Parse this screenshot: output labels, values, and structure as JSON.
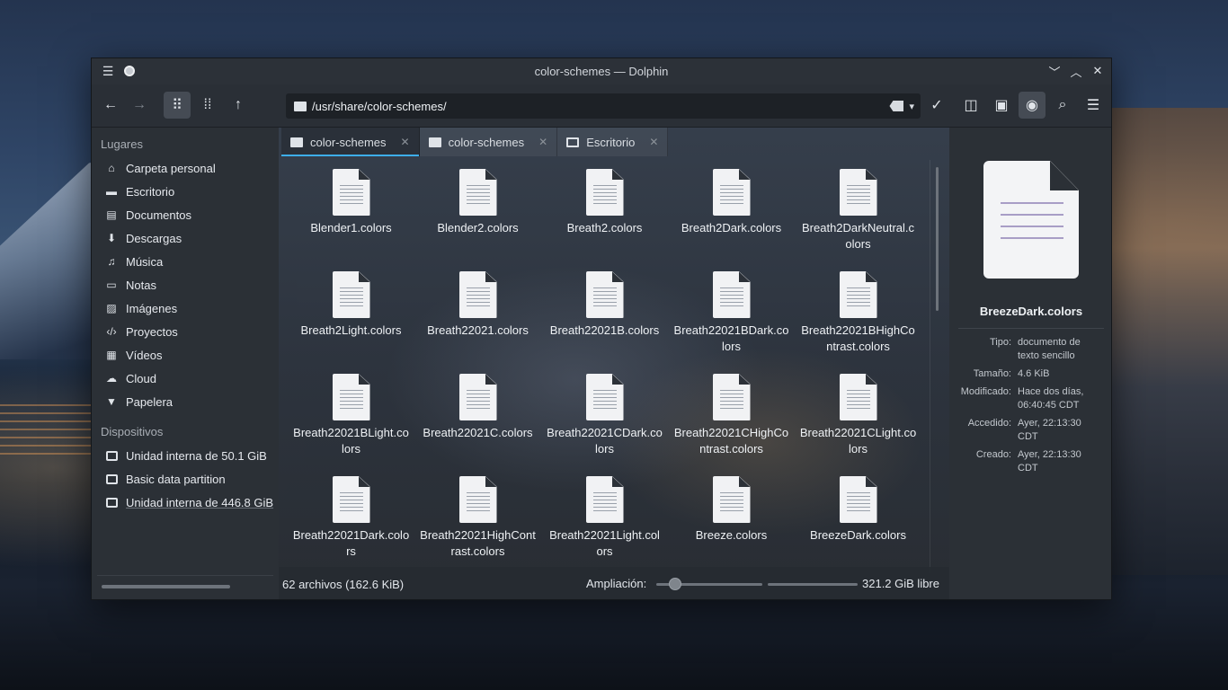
{
  "window": {
    "title": "color-schemes — Dolphin"
  },
  "toolbar": {
    "path": "/usr/share/color-schemes/"
  },
  "sidebar": {
    "places_header": "Lugares",
    "places": [
      {
        "label": "Carpeta personal",
        "icon": "home-icon"
      },
      {
        "label": "Escritorio",
        "icon": "desktop-icon"
      },
      {
        "label": "Documentos",
        "icon": "documents-icon"
      },
      {
        "label": "Descargas",
        "icon": "downloads-icon"
      },
      {
        "label": "Música",
        "icon": "music-icon"
      },
      {
        "label": "Notas",
        "icon": "folder-icon"
      },
      {
        "label": "Imágenes",
        "icon": "pictures-icon"
      },
      {
        "label": "Proyectos",
        "icon": "code-icon"
      },
      {
        "label": "Vídeos",
        "icon": "videos-icon"
      },
      {
        "label": "Cloud",
        "icon": "cloud-icon"
      },
      {
        "label": "Papelera",
        "icon": "trash-icon"
      }
    ],
    "devices_header": "Dispositivos",
    "devices": [
      {
        "label": "Unidad interna de 50.1 GiB"
      },
      {
        "label": "Basic data partition"
      },
      {
        "label": "Unidad interna de 446.8 GiB"
      }
    ]
  },
  "tabs": [
    {
      "label": "color-schemes",
      "active": true
    },
    {
      "label": "color-schemes",
      "active": false
    },
    {
      "label": "Escritorio",
      "active": false
    }
  ],
  "files": [
    "Blender1.colors",
    "Blender2.colors",
    "Breath2.colors",
    "Breath2Dark.colors",
    "Breath2DarkNeutral.colors",
    "Breath2Light.colors",
    "Breath22021.colors",
    "Breath22021B.colors",
    "Breath22021BDark.colors",
    "Breath22021BHighContrast.colors",
    "Breath22021BLight.colors",
    "Breath22021C.colors",
    "Breath22021CDark.colors",
    "Breath22021CHighContrast.colors",
    "Breath22021CLight.colors",
    "Breath22021Dark.colors",
    "Breath22021HighContrast.colors",
    "Breath22021Light.colors",
    "Breeze.colors",
    "BreezeDark.colors"
  ],
  "status": {
    "count": "62 archivos (162.6 KiB)",
    "zoom_label": "Ampliación:",
    "zoom_level": 0.18,
    "free_space": "321.2 GiB libre"
  },
  "info": {
    "filename": "BreezeDark.colors",
    "rows": [
      {
        "key": "Tipo:",
        "value": "documento de texto sencillo"
      },
      {
        "key": "Tamaño:",
        "value": "4.6 KiB"
      },
      {
        "key": "Modificado:",
        "value": "Hace dos días, 06:40:45 CDT"
      },
      {
        "key": "Accedido:",
        "value": "Ayer, 22:13:30 CDT"
      },
      {
        "key": "Creado:",
        "value": "Ayer, 22:13:30 CDT"
      }
    ]
  },
  "colors": {
    "accent": "#3daee9",
    "window_bg": "#21262d"
  }
}
